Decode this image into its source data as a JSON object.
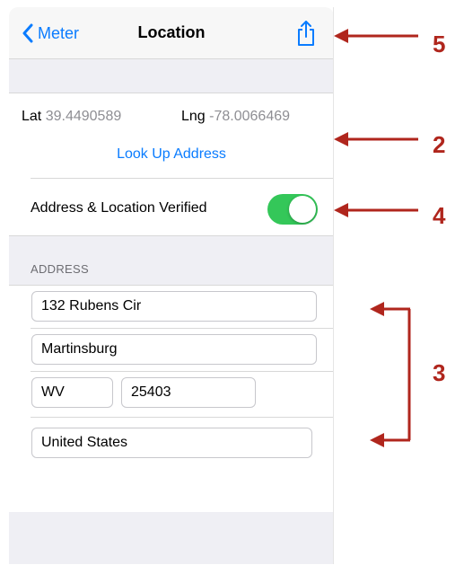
{
  "navbar": {
    "back_label": "Meter",
    "title": "Location"
  },
  "coords": {
    "lat_label": "Lat",
    "lat_value": "39.4490589",
    "lng_label": "Lng",
    "lng_value": "-78.0066469"
  },
  "lookup_label": "Look Up Address",
  "verified": {
    "label": "Address & Location Verified",
    "on": true
  },
  "address": {
    "header": "ADDRESS",
    "street": "132 Rubens Cir",
    "city": "Martinsburg",
    "state": "WV",
    "zip": "25403",
    "country": "United States"
  },
  "annotations": {
    "c5": "5",
    "c2": "2",
    "c4": "4",
    "c3": "3"
  },
  "colors": {
    "accent": "#0a7cff",
    "toggle_on": "#34c759",
    "annotation": "#b0261d"
  }
}
